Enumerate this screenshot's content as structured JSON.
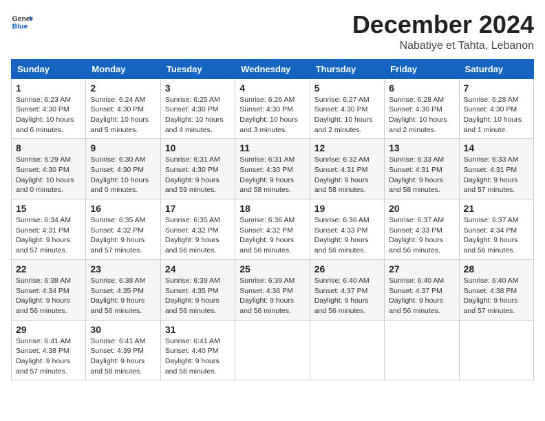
{
  "header": {
    "logo": {
      "general": "General",
      "blue": "Blue"
    },
    "title": "December 2024",
    "location": "Nabatiye et Tahta, Lebanon"
  },
  "weekdays": [
    "Sunday",
    "Monday",
    "Tuesday",
    "Wednesday",
    "Thursday",
    "Friday",
    "Saturday"
  ],
  "weeks": [
    [
      {
        "day": "1",
        "sunrise": "6:23 AM",
        "sunset": "4:30 PM",
        "daylight": "10 hours and 6 minutes."
      },
      {
        "day": "2",
        "sunrise": "6:24 AM",
        "sunset": "4:30 PM",
        "daylight": "10 hours and 5 minutes."
      },
      {
        "day": "3",
        "sunrise": "6:25 AM",
        "sunset": "4:30 PM",
        "daylight": "10 hours and 4 minutes."
      },
      {
        "day": "4",
        "sunrise": "6:26 AM",
        "sunset": "4:30 PM",
        "daylight": "10 hours and 3 minutes."
      },
      {
        "day": "5",
        "sunrise": "6:27 AM",
        "sunset": "4:30 PM",
        "daylight": "10 hours and 2 minutes."
      },
      {
        "day": "6",
        "sunrise": "6:28 AM",
        "sunset": "4:30 PM",
        "daylight": "10 hours and 2 minutes."
      },
      {
        "day": "7",
        "sunrise": "6:28 AM",
        "sunset": "4:30 PM",
        "daylight": "10 hours and 1 minute."
      }
    ],
    [
      {
        "day": "8",
        "sunrise": "6:29 AM",
        "sunset": "4:30 PM",
        "daylight": "10 hours and 0 minutes."
      },
      {
        "day": "9",
        "sunrise": "6:30 AM",
        "sunset": "4:30 PM",
        "daylight": "10 hours and 0 minutes."
      },
      {
        "day": "10",
        "sunrise": "6:31 AM",
        "sunset": "4:30 PM",
        "daylight": "9 hours and 59 minutes."
      },
      {
        "day": "11",
        "sunrise": "6:31 AM",
        "sunset": "4:30 PM",
        "daylight": "9 hours and 58 minutes."
      },
      {
        "day": "12",
        "sunrise": "6:32 AM",
        "sunset": "4:31 PM",
        "daylight": "9 hours and 58 minutes."
      },
      {
        "day": "13",
        "sunrise": "6:33 AM",
        "sunset": "4:31 PM",
        "daylight": "9 hours and 58 minutes."
      },
      {
        "day": "14",
        "sunrise": "6:33 AM",
        "sunset": "4:31 PM",
        "daylight": "9 hours and 57 minutes."
      }
    ],
    [
      {
        "day": "15",
        "sunrise": "6:34 AM",
        "sunset": "4:31 PM",
        "daylight": "9 hours and 57 minutes."
      },
      {
        "day": "16",
        "sunrise": "6:35 AM",
        "sunset": "4:32 PM",
        "daylight": "9 hours and 57 minutes."
      },
      {
        "day": "17",
        "sunrise": "6:35 AM",
        "sunset": "4:32 PM",
        "daylight": "9 hours and 56 minutes."
      },
      {
        "day": "18",
        "sunrise": "6:36 AM",
        "sunset": "4:32 PM",
        "daylight": "9 hours and 56 minutes."
      },
      {
        "day": "19",
        "sunrise": "6:36 AM",
        "sunset": "4:33 PM",
        "daylight": "9 hours and 56 minutes."
      },
      {
        "day": "20",
        "sunrise": "6:37 AM",
        "sunset": "4:33 PM",
        "daylight": "9 hours and 56 minutes."
      },
      {
        "day": "21",
        "sunrise": "6:37 AM",
        "sunset": "4:34 PM",
        "daylight": "9 hours and 56 minutes."
      }
    ],
    [
      {
        "day": "22",
        "sunrise": "6:38 AM",
        "sunset": "4:34 PM",
        "daylight": "9 hours and 56 minutes."
      },
      {
        "day": "23",
        "sunrise": "6:38 AM",
        "sunset": "4:35 PM",
        "daylight": "9 hours and 56 minutes."
      },
      {
        "day": "24",
        "sunrise": "6:39 AM",
        "sunset": "4:35 PM",
        "daylight": "9 hours and 56 minutes."
      },
      {
        "day": "25",
        "sunrise": "6:39 AM",
        "sunset": "4:36 PM",
        "daylight": "9 hours and 56 minutes."
      },
      {
        "day": "26",
        "sunrise": "6:40 AM",
        "sunset": "4:37 PM",
        "daylight": "9 hours and 56 minutes."
      },
      {
        "day": "27",
        "sunrise": "6:40 AM",
        "sunset": "4:37 PM",
        "daylight": "9 hours and 56 minutes."
      },
      {
        "day": "28",
        "sunrise": "6:40 AM",
        "sunset": "4:38 PM",
        "daylight": "9 hours and 57 minutes."
      }
    ],
    [
      {
        "day": "29",
        "sunrise": "6:41 AM",
        "sunset": "4:38 PM",
        "daylight": "9 hours and 57 minutes."
      },
      {
        "day": "30",
        "sunrise": "6:41 AM",
        "sunset": "4:39 PM",
        "daylight": "9 hours and 58 minutes."
      },
      {
        "day": "31",
        "sunrise": "6:41 AM",
        "sunset": "4:40 PM",
        "daylight": "9 hours and 58 minutes."
      },
      null,
      null,
      null,
      null
    ]
  ],
  "labels": {
    "sunrise": "Sunrise:",
    "sunset": "Sunset:",
    "daylight": "Daylight:"
  }
}
